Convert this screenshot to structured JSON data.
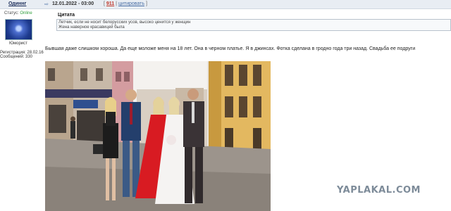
{
  "header": {
    "username": "Одиннг",
    "date": "12.01.2022 - 03:00",
    "number": "911",
    "cite_label": "цитировать",
    "bracket_open": "[",
    "separator": "|",
    "bracket_close": "]"
  },
  "user": {
    "status_label": "Статус:",
    "status_value": "Online",
    "rank": "Юморист",
    "registration": "Регистрация: 28.02.16",
    "messages": "Сообщений: 330"
  },
  "quote": {
    "title": "Цитата",
    "line1": "Летчик, если не носит белорусских усов, высоко ценится у женщин",
    "line2": "Жена наверное красавицей была"
  },
  "post": {
    "text": "Бывшая даже слишком хороша. Да еще моложе меня на 18 лет. Она в черном платье. Я в джинсах. Фотка сделана в гродно года три назад. Свадьба ее подруги"
  },
  "watermark": "YAPLAKAL.COM",
  "colors": {
    "header_bg": "#e8edf3",
    "online": "#2e9e3a",
    "red_dress": "#d81b22"
  }
}
